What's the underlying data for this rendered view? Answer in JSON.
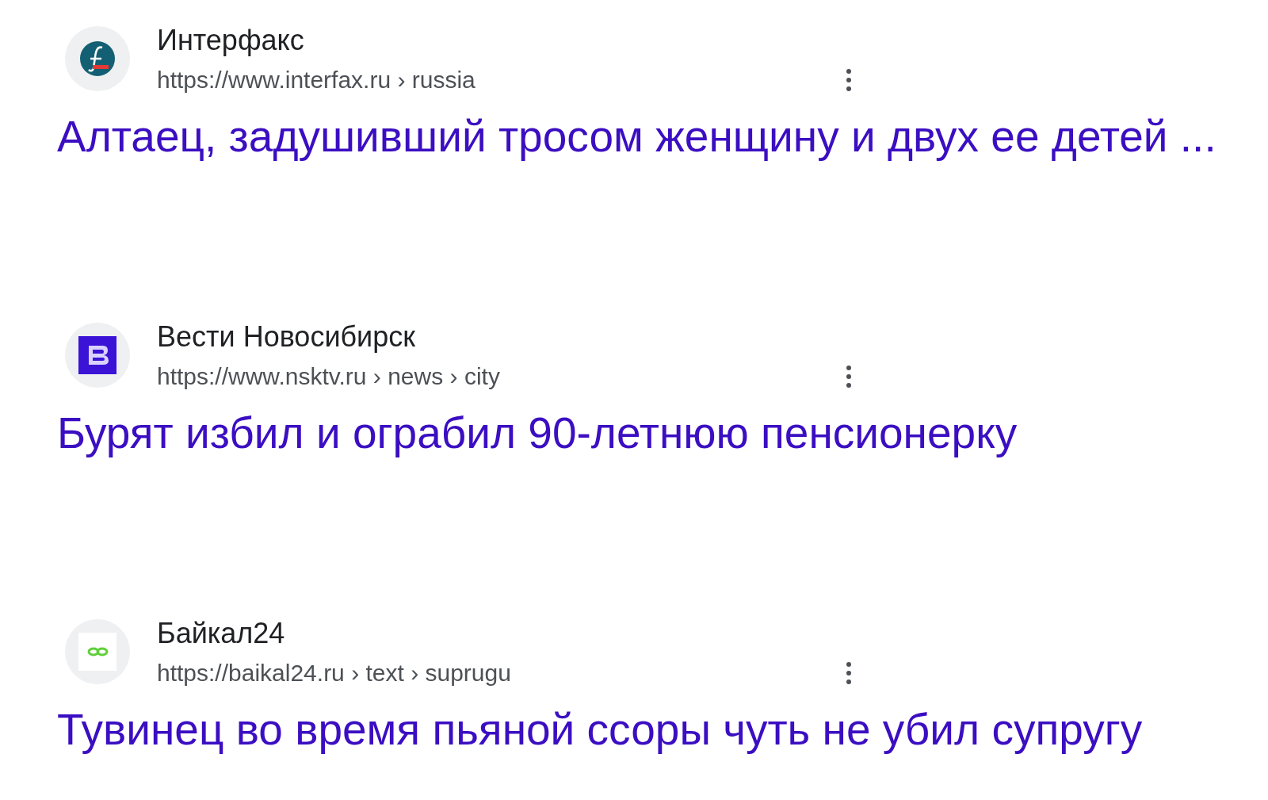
{
  "results": [
    {
      "kind": "interfax",
      "site": "Интерфакс",
      "url": "https://www.interfax.ru › russia",
      "title": "Алтаец, задушивший тросом женщину и двух ее детей ..."
    },
    {
      "kind": "vesti",
      "site": "Вести Новосибирск",
      "url": "https://www.nsktv.ru › news › city",
      "title": "Бурят избил и ограбил 90-летнюю пенсионерку"
    },
    {
      "kind": "baikal",
      "site": "Байкал24",
      "url": "https://baikal24.ru › text › suprugu",
      "title": "Тувинец во время пьяной ссоры чуть не убил супругу"
    }
  ]
}
